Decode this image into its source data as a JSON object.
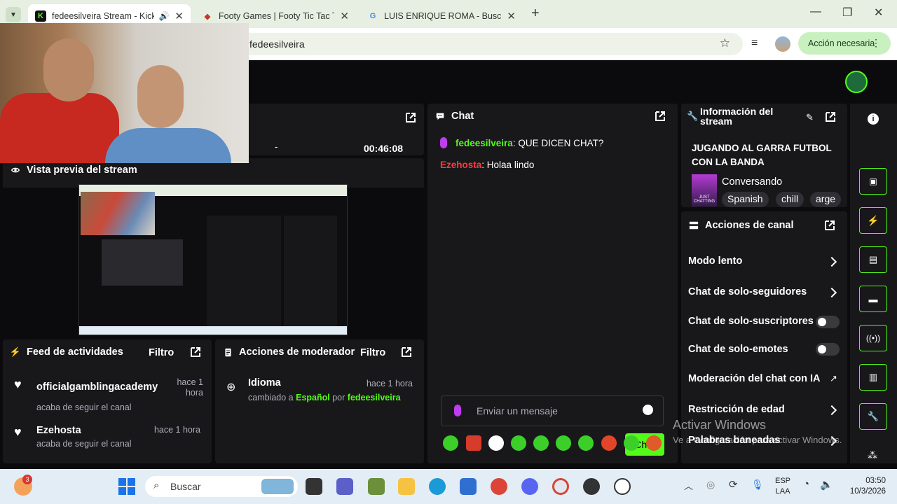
{
  "browser": {
    "tabs": [
      {
        "title": "fedeesilveira Stream - Kick D",
        "active": true
      },
      {
        "title": "Footy Games | Footy Tic Tac Toe",
        "active": false
      },
      {
        "title": "LUIS ENRIQUE ROMA - Buscar c",
        "active": false
      }
    ],
    "address": "fedeesilveira",
    "action_button": "Acción necesaria"
  },
  "stream_manager": {
    "timer": "00:46:08",
    "timer_dash": "-",
    "preview_title": "Vista previa del stream",
    "activity_feed": {
      "title": "Feed de actividades",
      "filter": "Filtro",
      "items": [
        {
          "user": "officialgamblingacademy",
          "time": "hace 1 hora",
          "text": "acaba de seguir el canal"
        },
        {
          "user": "Ezehosta",
          "time": "hace 1 hora",
          "text": "acaba de seguir el canal"
        }
      ]
    },
    "mod_actions": {
      "title": "Acciones de moderador",
      "filter": "Filtro",
      "item": {
        "title": "Idioma",
        "time": "hace 1 hora",
        "prefix": "cambiado a",
        "value": "Español",
        "by": "por",
        "user": "fedeesilveira"
      }
    },
    "chat": {
      "title": "Chat",
      "messages": [
        {
          "user": "fedeesilveira",
          "text": "QUE DICEN CHAT?",
          "color": "#53fc18"
        },
        {
          "user": "Ezehosta",
          "text": "Holaa lindo",
          "color": "#ff3b3b"
        }
      ],
      "input_placeholder": "Enviar un mensaje",
      "send_label": "Chat"
    },
    "stream_info": {
      "title": "Información del stream",
      "stream_title": "JUGANDO AL GARRA FUTBOL CON LA BANDA",
      "category": "Conversando",
      "category_art": "JUST CHATTING",
      "tags": [
        "Spanish",
        "chill",
        "arge"
      ]
    },
    "channel_actions": {
      "title": "Acciones de canal",
      "items": [
        {
          "label": "Modo lento",
          "control": "chevron"
        },
        {
          "label": "Chat de solo-seguidores",
          "control": "chevron"
        },
        {
          "label": "Chat de solo-suscriptores",
          "control": "toggle"
        },
        {
          "label": "Chat de solo-emotes",
          "control": "toggle"
        },
        {
          "label": "Moderación del chat con IA",
          "control": "external"
        },
        {
          "label": "Restricción de edad",
          "control": "chevron"
        },
        {
          "label": "Palabras baneadas",
          "control": "chevron"
        }
      ]
    }
  },
  "watermark": {
    "title": "Activar Windows",
    "subtitle": "Ve a Configuración para activar Windows."
  },
  "taskbar": {
    "search_placeholder": "Buscar",
    "weather_badge": "3",
    "language": "ESP",
    "layout": "LAA",
    "time": "03:50",
    "date": "10/3/2026"
  },
  "colors": {
    "accent": "#53fc18",
    "panel": "#18181b",
    "background": "#0b0b0d"
  }
}
